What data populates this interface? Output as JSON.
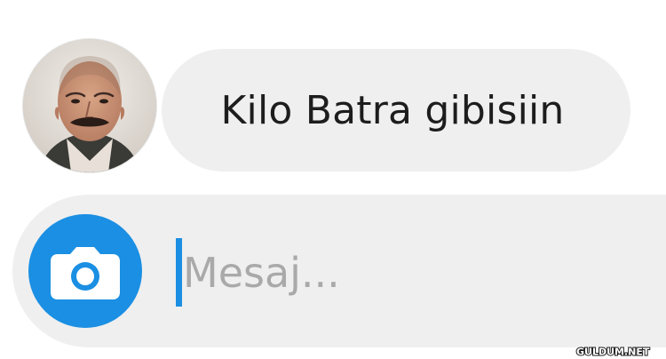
{
  "message": {
    "text": "Kilo Batra gibisiin"
  },
  "composer": {
    "placeholder": "Mesaj..."
  },
  "watermark": {
    "text": "GULDUM.NET"
  },
  "colors": {
    "accent": "#1a8fe3",
    "bubble": "#efefef",
    "text": "#1d1d1d",
    "placeholder": "#a9a9a9"
  },
  "icons": {
    "avatar": "profile-photo",
    "camera": "camera-icon"
  }
}
